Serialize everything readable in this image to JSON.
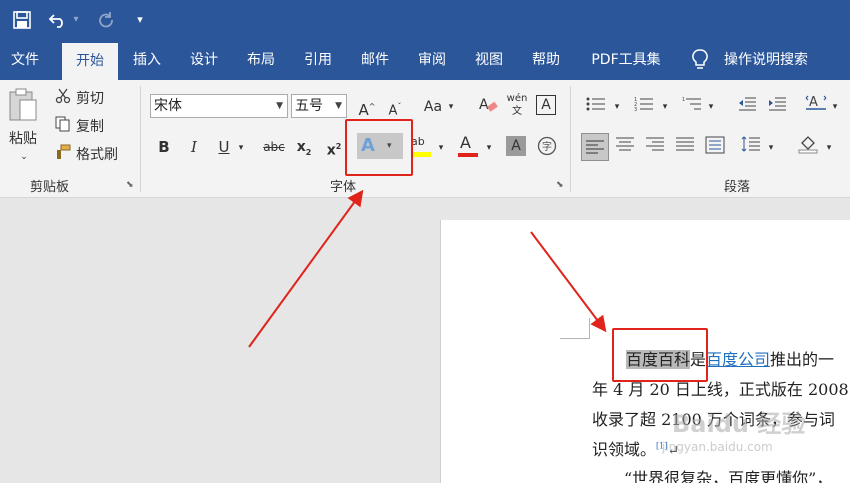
{
  "quick_access": {
    "save_icon": "save-icon",
    "undo_icon": "undo-icon",
    "redo_icon": "redo-icon",
    "customize_icon": "customize-icon"
  },
  "tabs": [
    {
      "label": "文件"
    },
    {
      "label": "开始",
      "active": true
    },
    {
      "label": "插入"
    },
    {
      "label": "设计"
    },
    {
      "label": "布局"
    },
    {
      "label": "引用"
    },
    {
      "label": "邮件"
    },
    {
      "label": "审阅"
    },
    {
      "label": "视图"
    },
    {
      "label": "帮助"
    },
    {
      "label": "PDF工具集"
    }
  ],
  "tell_me": "操作说明搜索",
  "clipboard": {
    "paste": "粘贴",
    "cut": "剪切",
    "copy": "复制",
    "format_painter": "格式刷",
    "group_label": "剪贴板"
  },
  "font": {
    "font_name": "宋体",
    "font_size": "五号",
    "change_case": "Aa",
    "bold": "B",
    "italic": "I",
    "underline": "U",
    "strikethrough": "abc",
    "subscript": "x",
    "subscript_mark": "2",
    "superscript": "x",
    "superscript_mark": "2",
    "text_effects": "A",
    "highlight_label": "ab",
    "font_color": "A",
    "char_shading": "A",
    "group_label": "字体",
    "highlight_color": "#ffff00",
    "font_color_bar": "#e0241b"
  },
  "paragraph": {
    "group_label": "段落"
  },
  "document": {
    "para1_highlight": "百度百科",
    "para1_text1": "是",
    "para1_link": "百度公司",
    "para1_text2": "推出的一",
    "line2": "年 4 月 20 日上线，正式版在 2008",
    "line3": "收录了超 2100 万个词条，参与词",
    "line4": "识领域。",
    "line4_ref": "[1]",
    "line5": "“世界很复杂，百度更懂你”，"
  },
  "watermark": {
    "text": "Baidu 经验",
    "url": "jingyan.baidu.com"
  },
  "colors": {
    "ribbon_blue": "#2b579a",
    "callout_red": "#e0241b"
  }
}
